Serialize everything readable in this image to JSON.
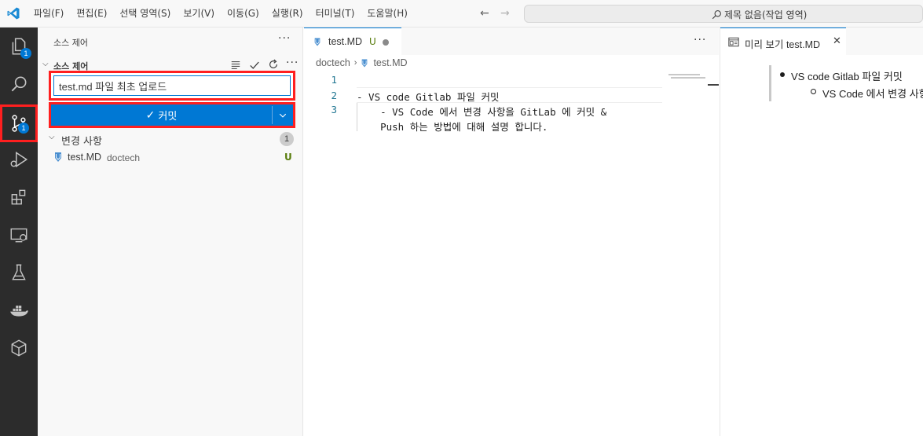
{
  "menu": {
    "items": [
      "파일(F)",
      "편집(E)",
      "선택 영역(S)",
      "보기(V)",
      "이동(G)",
      "실행(R)",
      "터미널(T)",
      "도움말(H)"
    ]
  },
  "titlebar": {
    "back_arrow": "←",
    "forward_arrow": "→",
    "search_text": "제목 없음(작업 영역)"
  },
  "activity": {
    "explorer_badge": "1",
    "scm_badge": "1",
    "icons": [
      "explorer-icon",
      "search-icon",
      "source-control-icon",
      "run-debug-icon",
      "extensions-icon",
      "remote-explorer-icon",
      "testing-icon",
      "docker-icon",
      "package-icon"
    ]
  },
  "sidebar": {
    "title": "소스 제어",
    "more": "···",
    "section_label": "소스 제어",
    "commit_message": "test.md 파일 최초 업로드",
    "commit_check": "✓",
    "commit_label": "커밋",
    "changes_label": "변경 사항",
    "changes_count": "1",
    "file": {
      "name": "test.MD",
      "dir": "doctech",
      "status": "U"
    }
  },
  "editor": {
    "tab_name": "test.MD",
    "tab_status": "U",
    "more": "···",
    "breadcrumb": [
      "doctech",
      "test.MD"
    ],
    "line_numbers": [
      "1",
      "2",
      "3"
    ],
    "lines": [
      "",
      "- VS code Gitlab 파일 커밋",
      "    - VS Code 에서 변경 사항을 GitLab 에 커밋 &",
      "    Push 하는 방법에 대해 설명 합니다."
    ]
  },
  "preview": {
    "tab_name": "미리 보기 test.MD",
    "close": "✕",
    "item1": "VS code Gitlab 파일 커밋",
    "item2": "VS Code 에서 변경 사항을 GitLab 에 커밋 & Push 하는 방법에 대해 설명 합니다."
  },
  "colors": {
    "accent": "#0078d4",
    "highlight_border": "#ff1f1f",
    "activity_bg": "#2c2c2c",
    "untracked": "#587c0c"
  }
}
